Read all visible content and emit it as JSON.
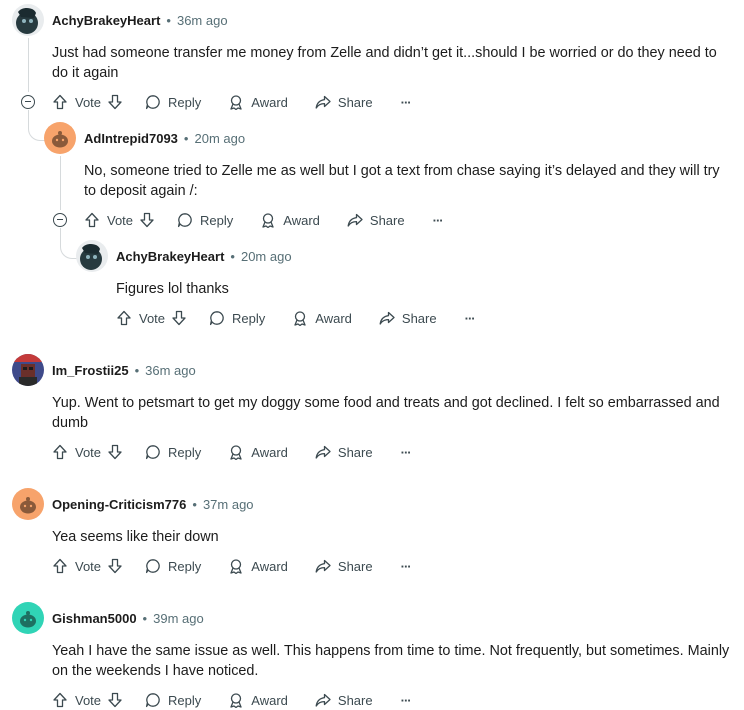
{
  "comments": [
    {
      "author": "AchyBrakeyHeart",
      "time": "36m ago",
      "lines": [
        "Just had someone transfer me money from Zelle and didn’t get it...should I be worried or do they need to",
        "do it again"
      ]
    },
    {
      "author": "AdIntrepid7093",
      "time": "20m ago",
      "lines": [
        "No, someone tried to Zelle me as well but I got a text from chase saying it’s delayed and they will try",
        "to deposit again /:"
      ]
    },
    {
      "author": "AchyBrakeyHeart",
      "time": "20m ago",
      "lines": [
        "Figures lol thanks"
      ]
    },
    {
      "author": "Im_Frostii25",
      "time": "36m ago",
      "lines": [
        "Yup. Went to petsmart to get my doggy some food and treats and got declined. I felt so embarrassed and",
        "dumb"
      ]
    },
    {
      "author": "Opening-Criticism776",
      "time": "37m ago",
      "lines": [
        "Yea seems like their down"
      ]
    },
    {
      "author": "Gishman5000",
      "time": "39m ago",
      "lines": [
        "Yeah I have the same issue as well. This happens from time to time. Not frequently, but sometimes. Mainly",
        "on the weekends I have noticed."
      ]
    }
  ],
  "actions": {
    "vote": "Vote",
    "reply": "Reply",
    "award": "Award",
    "share": "Share",
    "more": "···"
  },
  "separator": "•",
  "colors": {
    "snoo_orange": "#f7a36b",
    "snoo_teal": "#30d4b6",
    "thread_line": "#d6dadc",
    "text_secondary": "#576f76"
  },
  "icons": [
    "upvote-icon",
    "downvote-icon",
    "reply-bubble-icon",
    "award-icon",
    "share-arrow-icon",
    "more-icon",
    "collapse-icon"
  ]
}
